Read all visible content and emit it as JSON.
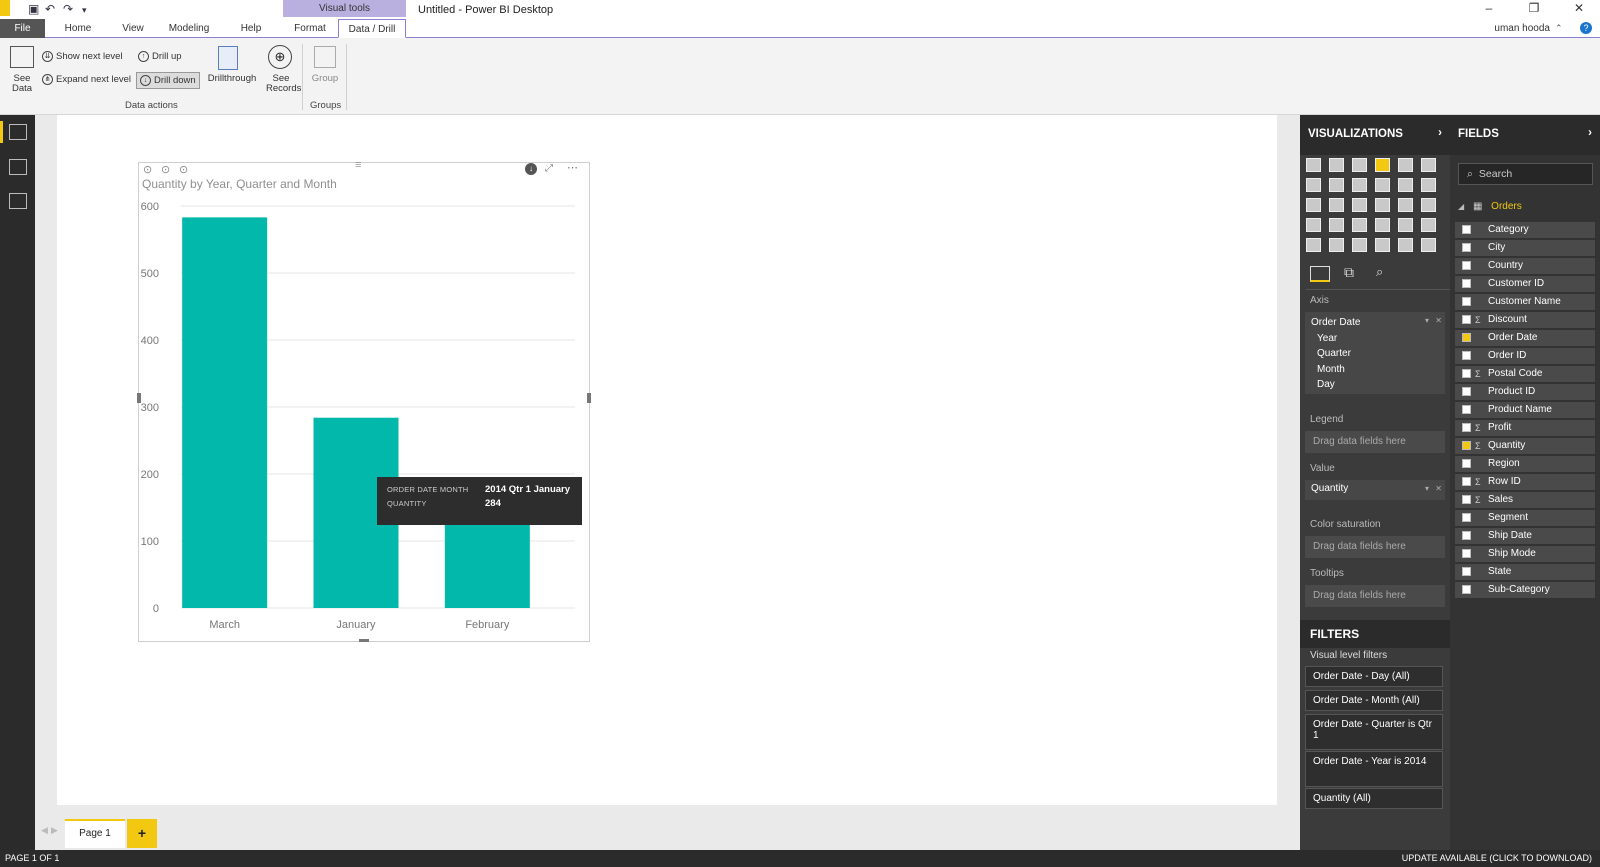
{
  "window": {
    "title": "Untitled - Power BI Desktop",
    "context_tab": "Visual tools",
    "user": "uman hooda"
  },
  "ribbon_tabs": [
    "File",
    "Home",
    "View",
    "Modeling",
    "Help",
    "Format",
    "Data / Drill"
  ],
  "ribbon": {
    "see_data": "See\nData",
    "show_next_level": "Show next level",
    "expand_next_level": "Expand next level",
    "drill_up": "Drill up",
    "drill_down": "Drill down",
    "drillthrough": "Drillthrough",
    "see_records": "See\nRecords",
    "group": "Group",
    "group_data_actions": "Data actions",
    "group_groups": "Groups"
  },
  "visual": {
    "title": "Quantity by Year, Quarter and Month"
  },
  "chart_data": {
    "type": "bar",
    "title": "Quantity by Year, Quarter and Month",
    "categories": [
      "March",
      "January",
      "February"
    ],
    "values": [
      583,
      284,
      131
    ],
    "ylim": [
      0,
      600
    ],
    "yticks": [
      0,
      100,
      200,
      300,
      400,
      500,
      600
    ],
    "color": "#01b8aa",
    "grid": true
  },
  "tooltip": {
    "k1": "ORDER DATE MONTH",
    "v1": "2014 Qtr 1 January",
    "k2": "QUANTITY",
    "v2": "284"
  },
  "pages": {
    "tab": "Page 1",
    "add": "+"
  },
  "status": {
    "left": "PAGE 1 OF 1",
    "right": "UPDATE AVAILABLE (CLICK TO DOWNLOAD)"
  },
  "viz": {
    "header": "VISUALIZATIONS",
    "axis_label": "Axis",
    "axis_field": "Order Date",
    "axis_subs": [
      "Year",
      "Quarter",
      "Month",
      "Day"
    ],
    "legend_label": "Legend",
    "drag": "Drag data fields here",
    "value_label": "Value",
    "value_field": "Quantity",
    "color_sat_label": "Color saturation",
    "tooltips_label": "Tooltips"
  },
  "filters": {
    "header": "FILTERS",
    "visual_level": "Visual level filters",
    "items": [
      "Order Date - Day (All)",
      "Order Date - Month (All)",
      "Order Date - Quarter is Qtr 1",
      "Order Date - Year is 2014",
      "Quantity (All)"
    ]
  },
  "fields": {
    "header": "FIELDS",
    "search_placeholder": "Search",
    "table": "Orders",
    "items": [
      {
        "name": "Category",
        "sigma": false,
        "checked": false
      },
      {
        "name": "City",
        "sigma": false,
        "checked": false
      },
      {
        "name": "Country",
        "sigma": false,
        "checked": false
      },
      {
        "name": "Customer ID",
        "sigma": false,
        "checked": false
      },
      {
        "name": "Customer Name",
        "sigma": false,
        "checked": false
      },
      {
        "name": "Discount",
        "sigma": true,
        "checked": false
      },
      {
        "name": "Order Date",
        "sigma": false,
        "checked": true
      },
      {
        "name": "Order ID",
        "sigma": false,
        "checked": false
      },
      {
        "name": "Postal Code",
        "sigma": true,
        "checked": false
      },
      {
        "name": "Product ID",
        "sigma": false,
        "checked": false
      },
      {
        "name": "Product Name",
        "sigma": false,
        "checked": false
      },
      {
        "name": "Profit",
        "sigma": true,
        "checked": false
      },
      {
        "name": "Quantity",
        "sigma": true,
        "checked": true
      },
      {
        "name": "Region",
        "sigma": false,
        "checked": false
      },
      {
        "name": "Row ID",
        "sigma": true,
        "checked": false
      },
      {
        "name": "Sales",
        "sigma": true,
        "checked": false
      },
      {
        "name": "Segment",
        "sigma": false,
        "checked": false
      },
      {
        "name": "Ship Date",
        "sigma": false,
        "checked": false
      },
      {
        "name": "Ship Mode",
        "sigma": false,
        "checked": false
      },
      {
        "name": "State",
        "sigma": false,
        "checked": false
      },
      {
        "name": "Sub-Category",
        "sigma": false,
        "checked": false
      }
    ]
  },
  "colors": {
    "accent": "#f2c811",
    "bar": "#01b8aa",
    "context": "#b9b0e0"
  }
}
